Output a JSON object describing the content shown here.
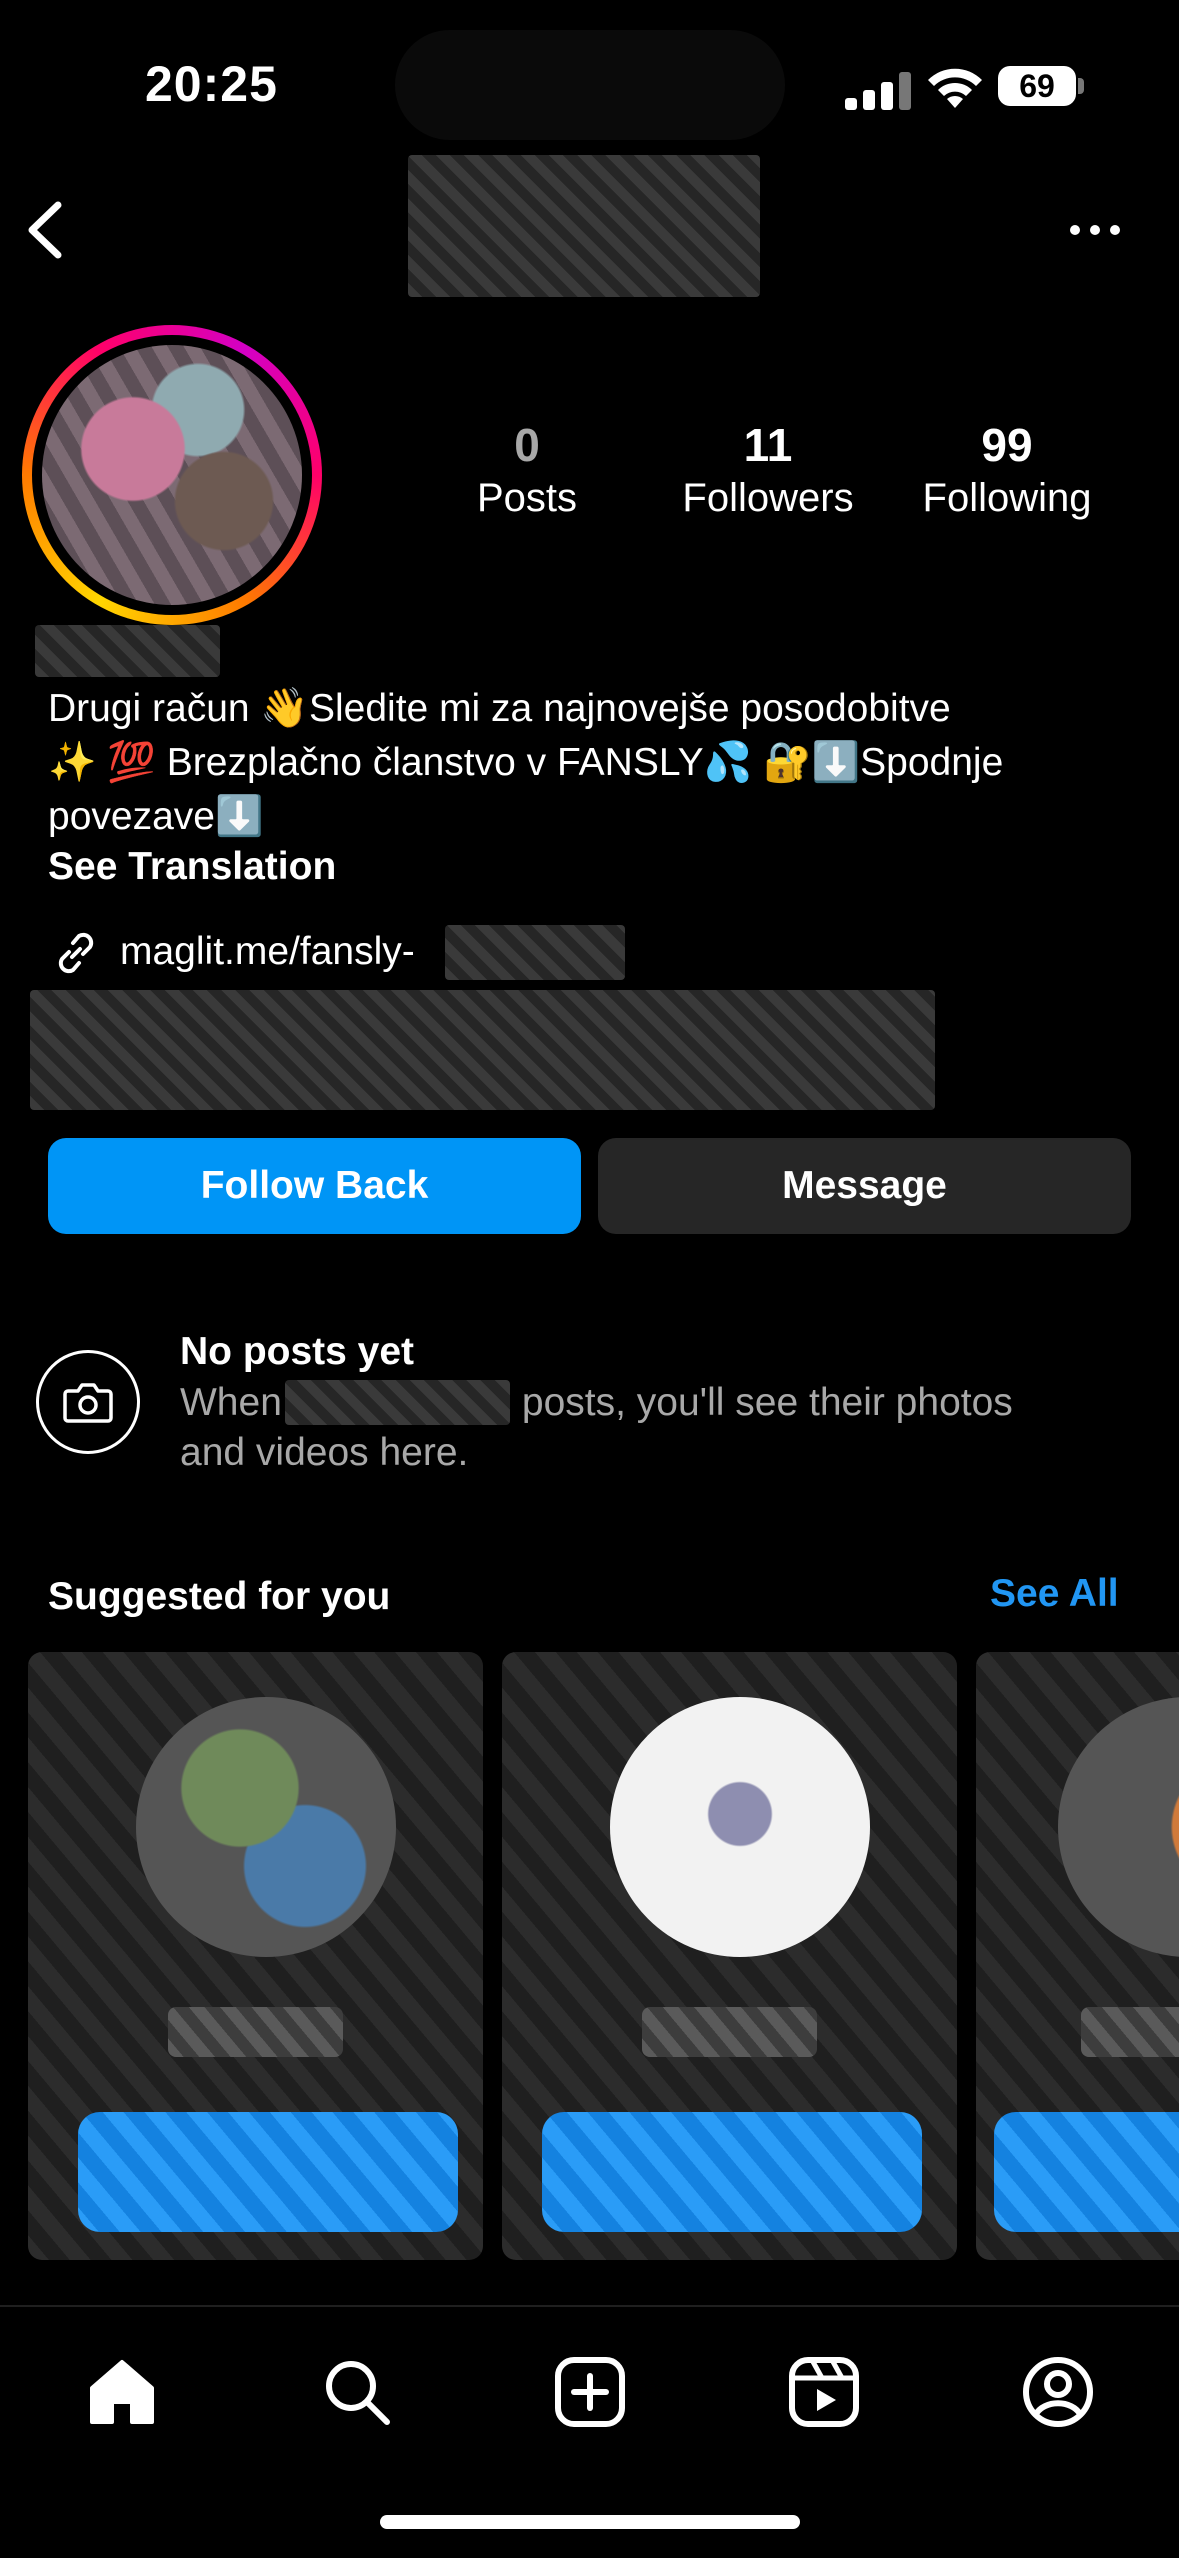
{
  "status_bar": {
    "time": "20:25",
    "battery": "69"
  },
  "header": {
    "back_icon": "chevron-left-icon",
    "more_icon": "more-horizontal-icon"
  },
  "profile": {
    "stats": [
      {
        "value": "0",
        "label": "Posts"
      },
      {
        "value": "11",
        "label": "Followers"
      },
      {
        "value": "99",
        "label": "Following"
      }
    ],
    "bio_line_1": "Drugi račun 👋Sledite mi za najnovejše posodobitve",
    "bio_line_2": "✨ 💯 Brezplačno članstvo v FANSLY💦 🔐⬇️Spodnje",
    "bio_line_3": "povezave⬇️",
    "see_translation": "See Translation",
    "link_text": "maglit.me/fansly-"
  },
  "actions": {
    "follow_back": "Follow Back",
    "message": "Message"
  },
  "no_posts": {
    "title": "No posts yet",
    "desc_prefix": "When",
    "desc_suffix": "posts, you'll see their photos",
    "desc_line_2": "and videos here."
  },
  "suggested": {
    "title": "Suggested for you",
    "see_all": "See All"
  },
  "tabbar": {
    "items": [
      "home-icon",
      "search-icon",
      "create-icon",
      "reels-icon",
      "profile-icon"
    ]
  },
  "colors": {
    "accent": "#0095f6",
    "link_blue": "#2196f3",
    "secondary_button": "#262626"
  }
}
